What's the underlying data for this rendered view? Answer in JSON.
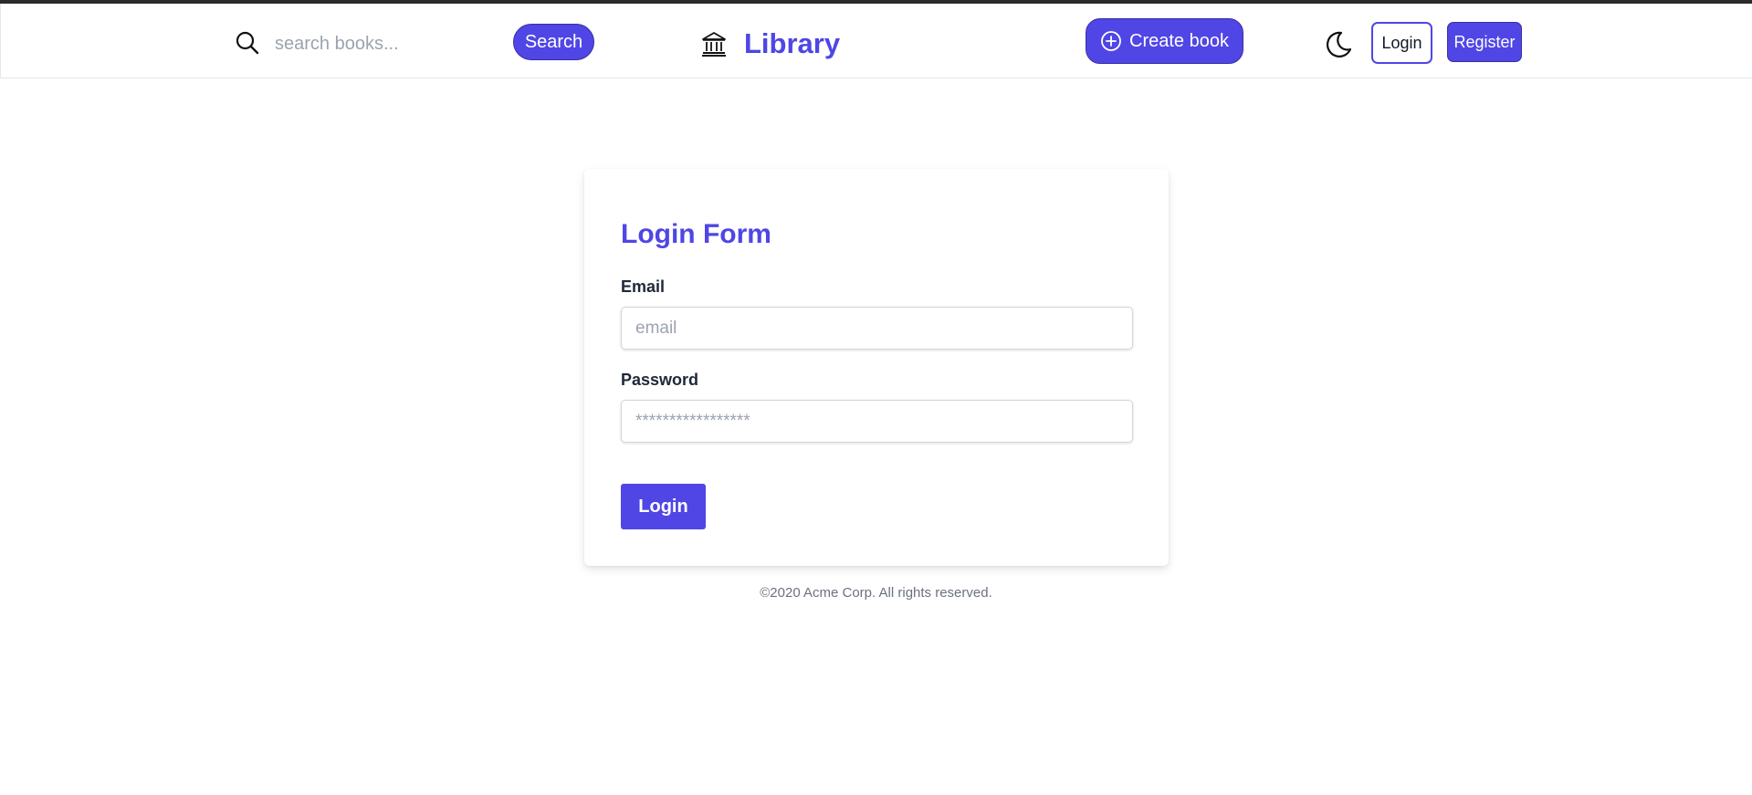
{
  "header": {
    "search": {
      "placeholder": "search books...",
      "button_label": "Search"
    },
    "brand": {
      "icon": "library-icon",
      "title": "Library"
    },
    "create_button": {
      "icon": "plus-circle-icon",
      "label": "Create book"
    },
    "theme_toggle": {
      "icon": "moon-icon"
    },
    "login_label": "Login",
    "register_label": "Register"
  },
  "login_form": {
    "title": "Login Form",
    "email": {
      "label": "Email",
      "placeholder": "email",
      "value": ""
    },
    "password": {
      "label": "Password",
      "placeholder": "*****************",
      "value": ""
    },
    "submit_label": "Login"
  },
  "footer": {
    "text": "©2020 Acme Corp. All rights reserved."
  },
  "colors": {
    "accent": "#4f46e5",
    "text": "#1f2937",
    "muted": "#6b7280",
    "border": "#d1d5db"
  }
}
